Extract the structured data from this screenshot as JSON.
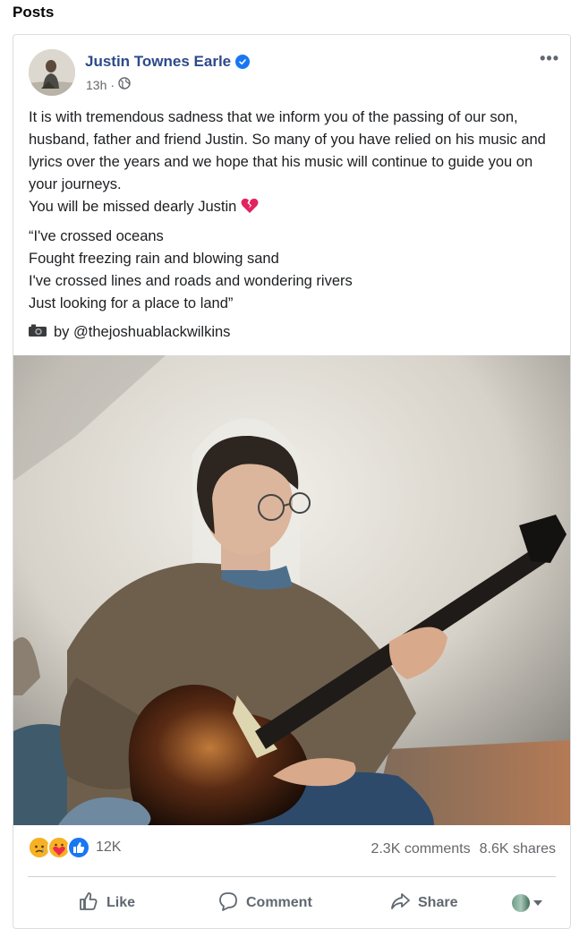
{
  "section": {
    "title": "Posts"
  },
  "post": {
    "author": "Justin Townes Earle",
    "time": "13h",
    "time_separator": "·",
    "paragraphs": [
      "It is with tremendous sadness that we inform you of the passing of our son, husband, father and friend Justin. So many of you have relied on his music and lyrics over the years and we hope that his music will continue to guide you on your journeys.",
      "You will be missed dearly Justin"
    ],
    "lyrics": [
      "“I've crossed oceans",
      "Fought freezing rain and blowing sand",
      "I've crossed lines and roads and wondering rivers",
      "Just looking for a place to land”"
    ],
    "credit": "by @thejoshuablackwilkins",
    "more_label": "•••"
  },
  "engagement": {
    "reaction_count": "12K",
    "comments": "2.3K comments",
    "shares": "8.6K shares"
  },
  "actions": {
    "like": "Like",
    "comment": "Comment",
    "share": "Share"
  },
  "colors": {
    "author_link": "#2d4a8a",
    "verified": "#1877f2",
    "secondary_text": "#65676b"
  }
}
